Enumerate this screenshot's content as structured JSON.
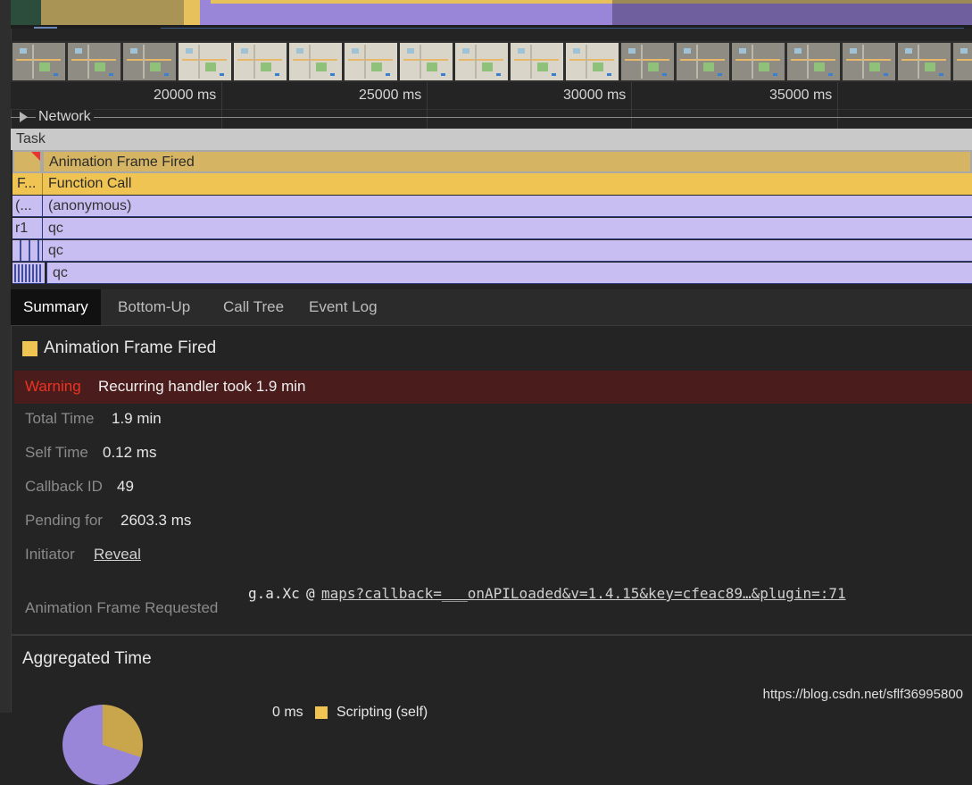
{
  "ruler": {
    "ticks": [
      "20000 ms",
      "25000 ms",
      "30000 ms",
      "35000 ms"
    ]
  },
  "network": {
    "label": "Network"
  },
  "flame": {
    "task": "Task",
    "animation_frame": "Animation Frame Fired",
    "function_short": "F...",
    "function_call": "Function Call",
    "anon_short": "(...",
    "anonymous": "(anonymous)",
    "r1": "r1",
    "qc1": "qc",
    "qc2": "qc",
    "qc3": "qc"
  },
  "tabs": [
    "Summary",
    "Bottom-Up",
    "Call Tree",
    "Event Log"
  ],
  "summary": {
    "title": "Animation Frame Fired",
    "swatch_color": "#f0c452",
    "warning_label": "Warning",
    "warning_text": "Recurring handler took 1.9 min",
    "total_time_label": "Total Time",
    "total_time_value": "1.9 min",
    "self_time_label": "Self Time",
    "self_time_value": "0.12 ms",
    "callback_id_label": "Callback ID",
    "callback_id_value": "49",
    "pending_label": "Pending for",
    "pending_value": "2603.3 ms",
    "initiator_label": "Initiator",
    "initiator_link": "Reveal",
    "afr_label": "Animation Frame Requested",
    "afr_func": "g.a.Xc",
    "afr_at": "@",
    "afr_link": "maps?callback=___onAPILoaded&v=1.4.15&key=cfeac89…&plugin=:71"
  },
  "aggregated": {
    "title": "Aggregated Time",
    "legend_value": "0 ms",
    "legend_label": "Scripting (self)"
  },
  "watermark": "https://blog.csdn.net/sflf36995800"
}
